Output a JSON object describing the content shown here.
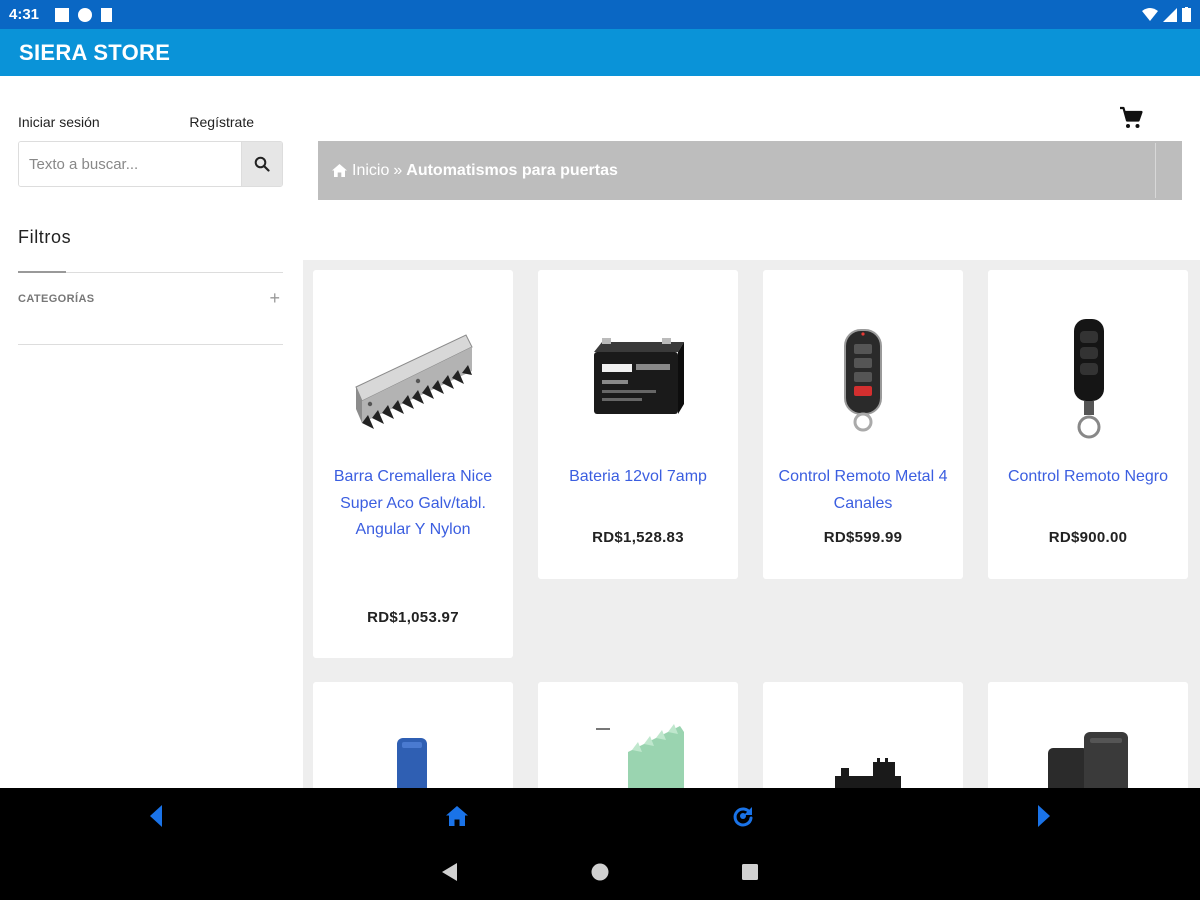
{
  "status_bar": {
    "time": "4:31"
  },
  "app_bar": {
    "title": "SIERA STORE"
  },
  "auth": {
    "login": "Iniciar sesión",
    "register": "Regístrate"
  },
  "search": {
    "placeholder": "Texto a buscar..."
  },
  "filters": {
    "title": "Filtros",
    "categories_label": "CATEGORÍAS",
    "expand_symbol": "+"
  },
  "breadcrumb": {
    "home": "Inicio",
    "separator": "»",
    "current": "Automatismos para puertas"
  },
  "products": [
    {
      "name": "Barra Cremallera Nice Super Aco Galv/tabl. Angular Y Nylon",
      "price": "RD$1,053.97"
    },
    {
      "name": "Bateria 12vol 7amp",
      "price": "RD$1,528.83"
    },
    {
      "name": "Control Remoto Metal 4 Canales",
      "price": "RD$599.99"
    },
    {
      "name": "Control Remoto Negro",
      "price": "RD$900.00"
    }
  ],
  "colors": {
    "status_bar": "#0a67c4",
    "app_bar": "#0a93d8",
    "link": "#3b5ee0",
    "breadcrumb_bg": "#bdbdbd",
    "nav_icon": "#1a73e8"
  },
  "icons": {
    "search": "magnifier-icon",
    "cart": "shopping-cart-icon",
    "home": "home-icon",
    "web_nav": [
      "back-arrow-icon",
      "home-icon",
      "reload-icon",
      "forward-arrow-icon"
    ],
    "system_nav": [
      "back-triangle-icon",
      "home-circle-icon",
      "recents-square-icon"
    ]
  }
}
